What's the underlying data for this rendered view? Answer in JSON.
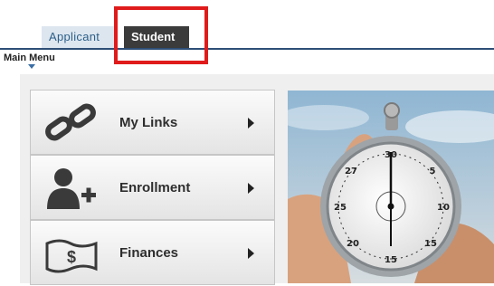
{
  "tabs": [
    {
      "label": "Applicant"
    },
    {
      "label": "Student"
    }
  ],
  "main_menu": {
    "label": "Main Menu"
  },
  "menu": {
    "items": [
      {
        "label": "My Links",
        "icon": "chain-link-icon"
      },
      {
        "label": "Enrollment",
        "icon": "add-person-icon"
      },
      {
        "label": "Finances",
        "icon": "dollar-bill-icon"
      }
    ]
  },
  "colors": {
    "highlight": "#e01b1b",
    "active_tab": "#3b3b3b",
    "inactive_tab": "#dde6ef",
    "tab_rule": "#2d4e76"
  },
  "photo": {
    "icon": "stopwatch-photo"
  }
}
